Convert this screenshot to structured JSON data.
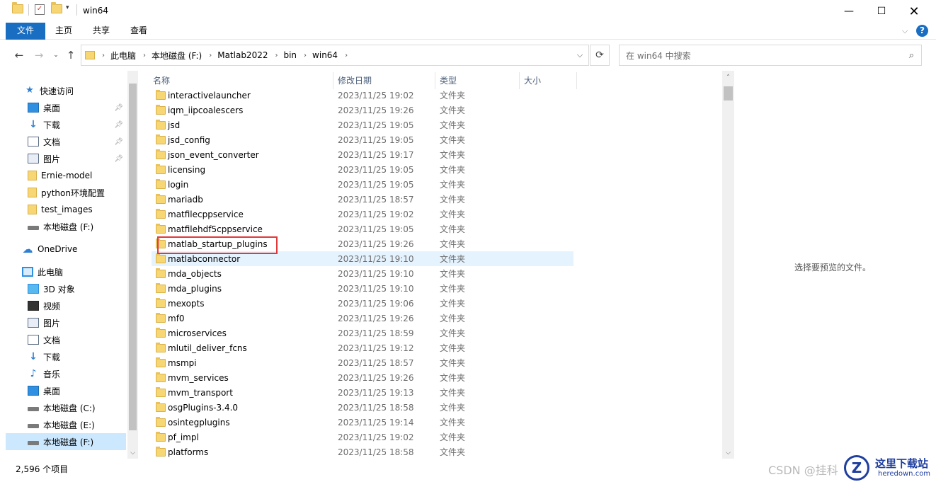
{
  "window": {
    "title": "win64"
  },
  "ribbon": {
    "tabs": [
      "文件",
      "主页",
      "共享",
      "查看"
    ]
  },
  "address": {
    "crumbs": [
      "此电脑",
      "本地磁盘 (F:)",
      "Matlab2022",
      "bin",
      "win64"
    ],
    "search_placeholder": "在 win64 中搜索"
  },
  "nav": {
    "items": [
      {
        "label": "快速访问",
        "icon": "star-icon"
      },
      {
        "label": "桌面",
        "icon": "desktop-icon",
        "pinned": true
      },
      {
        "label": "下载",
        "icon": "download-icon",
        "pinned": true
      },
      {
        "label": "文档",
        "icon": "document-icon",
        "pinned": true
      },
      {
        "label": "图片",
        "icon": "picture-icon",
        "pinned": true
      },
      {
        "label": "Ernie-model",
        "icon": "folder-icon"
      },
      {
        "label": "python环境配置",
        "icon": "folder-icon"
      },
      {
        "label": "test_images",
        "icon": "folder-icon"
      },
      {
        "label": "本地磁盘 (F:)",
        "icon": "drive-icon"
      },
      {
        "label": "OneDrive",
        "icon": "cloud-icon"
      },
      {
        "label": "此电脑",
        "icon": "pc-icon"
      },
      {
        "label": "3D 对象",
        "icon": "3d-objects-icon"
      },
      {
        "label": "视频",
        "icon": "video-icon"
      },
      {
        "label": "图片",
        "icon": "picture-icon"
      },
      {
        "label": "文档",
        "icon": "document-icon"
      },
      {
        "label": "下载",
        "icon": "download-icon"
      },
      {
        "label": "音乐",
        "icon": "music-icon"
      },
      {
        "label": "桌面",
        "icon": "desktop-icon"
      },
      {
        "label": "本地磁盘 (C:)",
        "icon": "drive-icon"
      },
      {
        "label": "本地磁盘 (E:)",
        "icon": "drive-icon"
      },
      {
        "label": "本地磁盘 (F:)",
        "icon": "drive-icon",
        "selected": true
      }
    ]
  },
  "columns": {
    "name": "名称",
    "date": "修改日期",
    "type": "类型",
    "size": "大小"
  },
  "files": [
    {
      "name": "interactivelauncher",
      "date": "2023/11/25 19:02",
      "type": "文件夹"
    },
    {
      "name": "iqm_iipcoalescers",
      "date": "2023/11/25 19:26",
      "type": "文件夹"
    },
    {
      "name": "jsd",
      "date": "2023/11/25 19:05",
      "type": "文件夹"
    },
    {
      "name": "jsd_config",
      "date": "2023/11/25 19:05",
      "type": "文件夹"
    },
    {
      "name": "json_event_converter",
      "date": "2023/11/25 19:17",
      "type": "文件夹"
    },
    {
      "name": "licensing",
      "date": "2023/11/25 19:05",
      "type": "文件夹"
    },
    {
      "name": "login",
      "date": "2023/11/25 19:05",
      "type": "文件夹"
    },
    {
      "name": "mariadb",
      "date": "2023/11/25 18:57",
      "type": "文件夹"
    },
    {
      "name": "matfilecppservice",
      "date": "2023/11/25 19:02",
      "type": "文件夹"
    },
    {
      "name": "matfilehdf5cppservice",
      "date": "2023/11/25 19:05",
      "type": "文件夹"
    },
    {
      "name": "matlab_startup_plugins",
      "date": "2023/11/25 19:26",
      "type": "文件夹"
    },
    {
      "name": "matlabconnector",
      "date": "2023/11/25 19:10",
      "type": "文件夹",
      "hover": true
    },
    {
      "name": "mda_objects",
      "date": "2023/11/25 19:10",
      "type": "文件夹"
    },
    {
      "name": "mda_plugins",
      "date": "2023/11/25 19:10",
      "type": "文件夹"
    },
    {
      "name": "mexopts",
      "date": "2023/11/25 19:06",
      "type": "文件夹"
    },
    {
      "name": "mf0",
      "date": "2023/11/25 19:26",
      "type": "文件夹"
    },
    {
      "name": "microservices",
      "date": "2023/11/25 18:59",
      "type": "文件夹"
    },
    {
      "name": "mlutil_deliver_fcns",
      "date": "2023/11/25 19:12",
      "type": "文件夹"
    },
    {
      "name": "msmpi",
      "date": "2023/11/25 18:57",
      "type": "文件夹"
    },
    {
      "name": "mvm_services",
      "date": "2023/11/25 19:26",
      "type": "文件夹"
    },
    {
      "name": "mvm_transport",
      "date": "2023/11/25 19:13",
      "type": "文件夹"
    },
    {
      "name": "osgPlugins-3.4.0",
      "date": "2023/11/25 18:58",
      "type": "文件夹"
    },
    {
      "name": "osintegplugins",
      "date": "2023/11/25 19:14",
      "type": "文件夹"
    },
    {
      "name": "pf_impl",
      "date": "2023/11/25 19:02",
      "type": "文件夹"
    },
    {
      "name": "platforms",
      "date": "2023/11/25 18:58",
      "type": "文件夹"
    }
  ],
  "preview": {
    "message": "选择要预览的文件。"
  },
  "status": {
    "item_count": "2,596 个项目"
  },
  "watermark": {
    "csdn": "CSDN @挂科",
    "site_cn": "这里下载站",
    "site_en": "heredown.com"
  }
}
